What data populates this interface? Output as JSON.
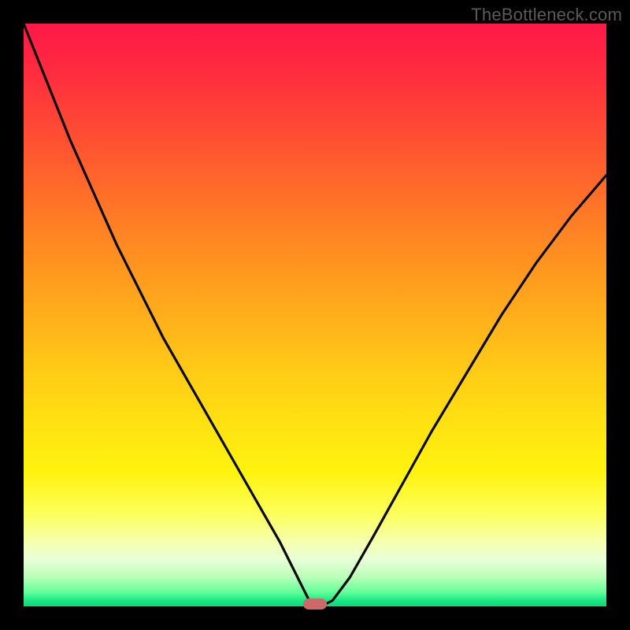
{
  "watermark": "TheBottleneck.com",
  "colors": {
    "frame_bg": "#000000",
    "curve_stroke": "#0a0a0a",
    "marker_fill": "#cc6a6a",
    "gradient_top": "#ff1848",
    "gradient_mid": "#ffe012",
    "gradient_bottom": "#0fd67b"
  },
  "chart_data": {
    "type": "line",
    "title": "",
    "xlabel": "",
    "ylabel": "",
    "xlim": [
      0,
      100
    ],
    "ylim": [
      0,
      100
    ],
    "grid": false,
    "legend": false,
    "notes": "V-shaped bottleneck curve over a vertical red→yellow→green gradient. Axes have no visible tick labels; x/y units are normalized 0–100. Minimum (~0) occurs near x≈50, curve rises steeply on both sides. A small rounded pink marker sits at the trough.",
    "series": [
      {
        "name": "bottleneck-curve",
        "x": [
          0,
          4,
          8,
          12,
          16,
          20,
          24,
          28,
          32,
          36,
          40,
          44,
          47,
          49,
          50,
          51,
          53,
          56,
          60,
          65,
          70,
          76,
          82,
          88,
          94,
          100
        ],
        "values": [
          100,
          90,
          80,
          71,
          62,
          54,
          46,
          39,
          32,
          25,
          18,
          11,
          5,
          1,
          0,
          0,
          1,
          5,
          12,
          21,
          30,
          40,
          50,
          59,
          67,
          74
        ]
      }
    ],
    "marker": {
      "x": 50,
      "y": 0
    }
  }
}
